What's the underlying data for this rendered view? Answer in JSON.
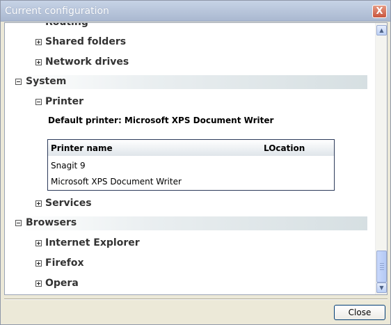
{
  "window": {
    "title": "Current configuration",
    "close_glyph": "X"
  },
  "tree": {
    "partial_top_label": "Routing",
    "shared_folders": "Shared folders",
    "network_drives": "Network drives",
    "system": "System",
    "printer": "Printer",
    "default_printer": "Default printer: Microsoft XPS Document Writer",
    "services": "Services",
    "browsers": "Browsers",
    "internet_explorer": "Internet Explorer",
    "firefox": "Firefox",
    "opera": "Opera"
  },
  "printer_table": {
    "columns": [
      "Printer name",
      "LOcation"
    ],
    "rows": [
      [
        "Snagit 9",
        ""
      ],
      [
        "Microsoft XPS Document Writer",
        ""
      ]
    ]
  },
  "scrollbar": {
    "up_icon": "arrow-up-icon",
    "down_icon": "arrow-down-icon",
    "position_fraction": 0.92
  },
  "footer": {
    "close_label": "Close"
  }
}
